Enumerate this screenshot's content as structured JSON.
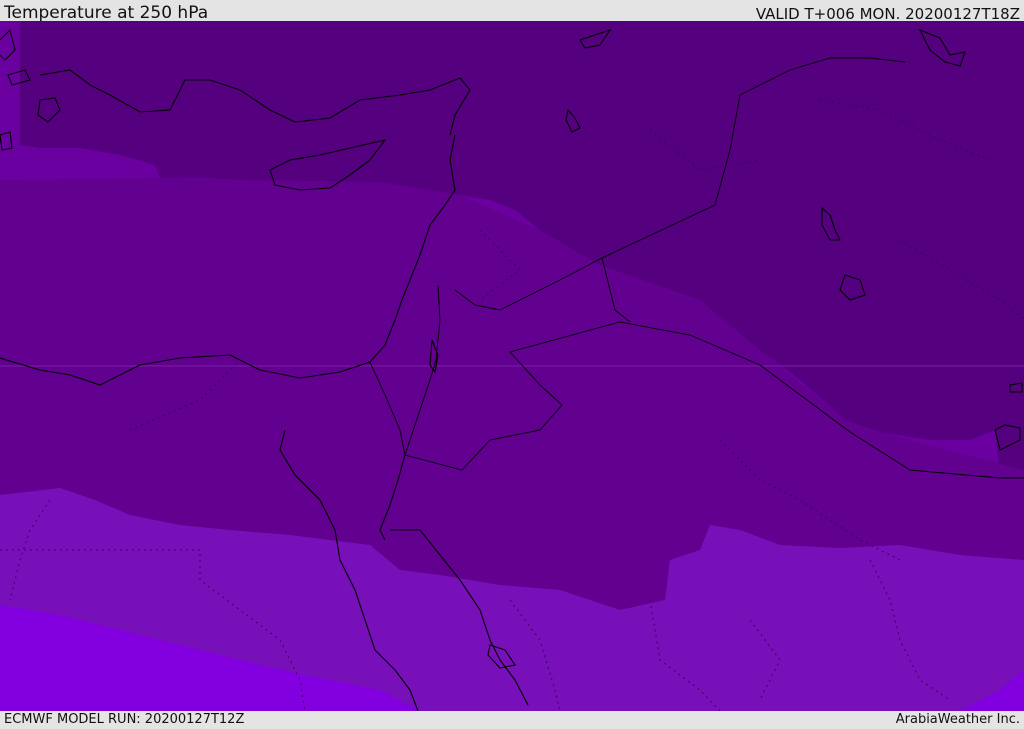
{
  "header": {
    "title": "Temperature at 250 hPa",
    "valid": "VALID T+006 MON. 20200127T18Z"
  },
  "footer": {
    "model_run": "ECMWF MODEL RUN: 20200127T12Z",
    "credit": "ArabiaWeather Inc."
  },
  "map": {
    "field": "temperature",
    "level": "250 hPa",
    "colors": {
      "coldest": "#55007f",
      "cold": "#62008f",
      "mid": "#6a00a0",
      "warm": "#7710b8",
      "warmest": "#8200e0",
      "coastline": "#000000"
    }
  }
}
